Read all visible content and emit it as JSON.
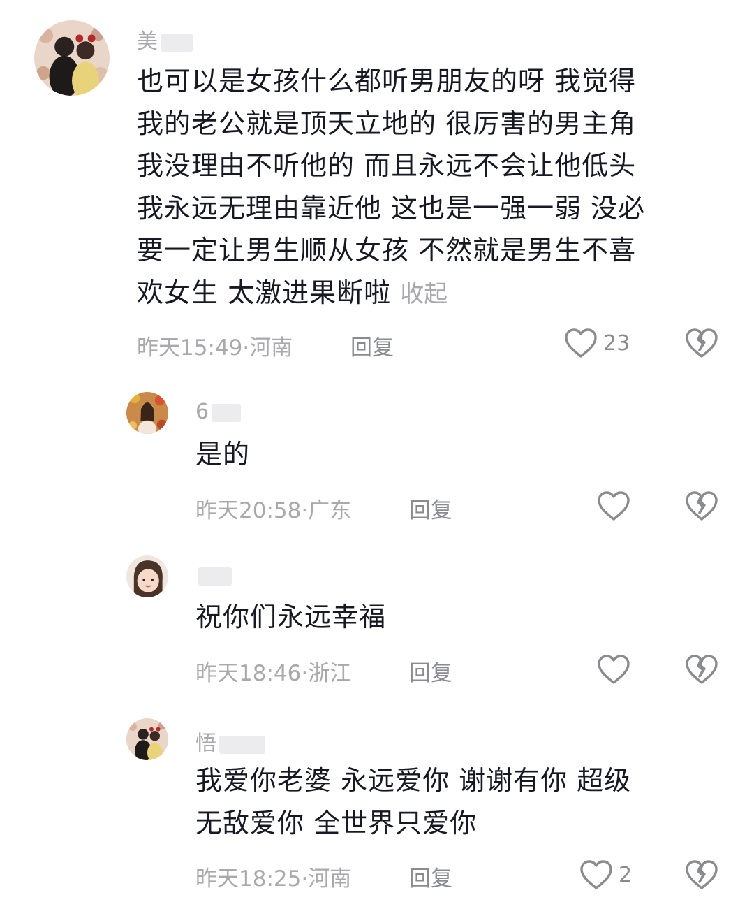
{
  "comments": [
    {
      "name": "美",
      "lines": [
        "也可以是女孩什么都听男朋友的呀 我觉得",
        "我的老公就是顶天立地的 很厉害的男主角",
        "我没理由不听他的 而且永远不会让他低头",
        "我永远无理由靠近他 这也是一强一弱 没必",
        "要一定让男生顺从女孩 不然就是男生不喜",
        "欢女生 太激进果断啦"
      ],
      "collapse": "收起",
      "meta": "昨天15:49·河南",
      "reply": "回复",
      "likes": "23"
    },
    {
      "name": "6",
      "lines": [
        "是的"
      ],
      "meta": "昨天20:58·广东",
      "reply": "回复",
      "likes": ""
    },
    {
      "name": "",
      "lines": [
        "祝你们永远幸福"
      ],
      "meta": "昨天18:46·浙江",
      "reply": "回复",
      "likes": ""
    },
    {
      "name": "悟",
      "lines": [
        "我爱你老婆 永远爱你 谢谢有你 超级",
        "无敌爱你 全世界只爱你"
      ],
      "meta": "昨天18:25·河南",
      "reply": "回复",
      "likes": "2"
    }
  ],
  "colors": {
    "text": "#161823",
    "secondary": "#a8a8ad",
    "icon": "#8a8b91",
    "background": "#ffffff"
  },
  "icons": {
    "like": "heart-outline-icon",
    "dislike": "broken-heart-icon"
  }
}
